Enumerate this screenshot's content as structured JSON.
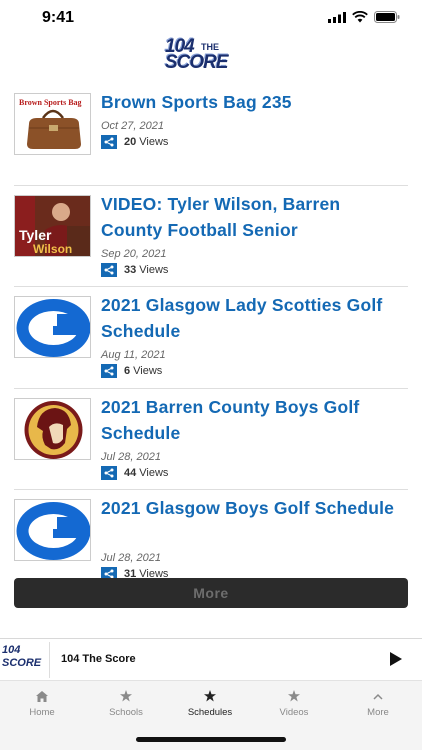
{
  "status": {
    "time": "9:41"
  },
  "logo": {
    "line1": "104",
    "sup": "THE",
    "line2": "SCORE"
  },
  "items": [
    {
      "title": "Brown Sports Bag 235",
      "date": "Oct 27, 2021",
      "views_count": "20",
      "views_label": "Views",
      "thumb": "brown-bag"
    },
    {
      "title": "VIDEO: Tyler Wilson, Barren County Football Senior",
      "date": "Sep 20, 2021",
      "views_count": "33",
      "views_label": "Views",
      "thumb": "tyler",
      "thumb_text_1": "Tyler",
      "thumb_text_2": "Wilson"
    },
    {
      "title": "2021 Glasgow Lady Scotties Golf Schedule",
      "date": "Aug 11, 2021",
      "views_count": "6",
      "views_label": "Views",
      "thumb": "glasgow-g"
    },
    {
      "title": "2021 Barren County Boys Golf Schedule",
      "date": "Jul 28, 2021",
      "views_count": "44",
      "views_label": "Views",
      "thumb": "trojan"
    },
    {
      "title": "2021 Glasgow Boys Golf Schedule",
      "date": "Jul 28, 2021",
      "views_count": "31",
      "views_label": "Views",
      "thumb": "glasgow-g"
    }
  ],
  "thumb_bag_title": "Brown Sports Bag",
  "more_label": "More",
  "player": {
    "logo1": "104",
    "logo2": "SCORE",
    "title": "104 The Score"
  },
  "tabs": [
    {
      "label": "Home",
      "icon": "home-icon"
    },
    {
      "label": "Schools",
      "icon": "star-icon"
    },
    {
      "label": "Schedules",
      "icon": "star-icon",
      "active": true
    },
    {
      "label": "Videos",
      "icon": "star-icon"
    },
    {
      "label": "More",
      "icon": "chevron-up-icon"
    }
  ],
  "colors": {
    "accent": "#1469b4",
    "logo": "#1b2f6e",
    "more_bg": "#2b2b2b"
  }
}
